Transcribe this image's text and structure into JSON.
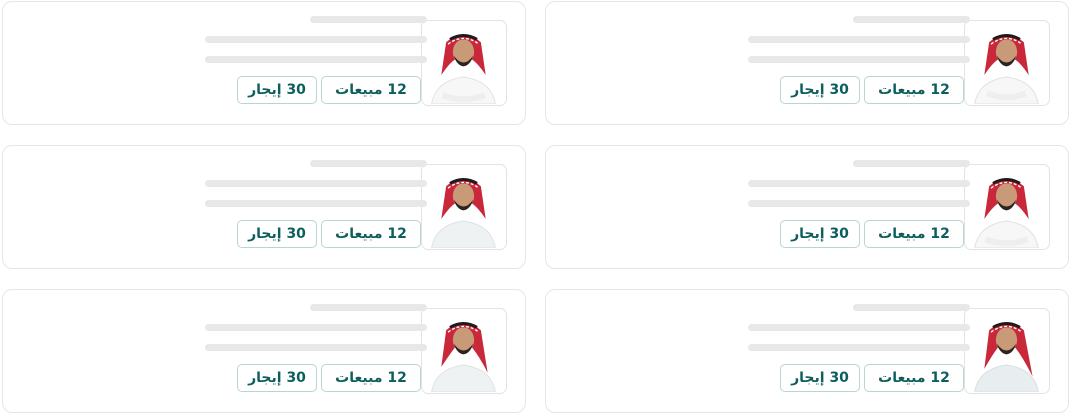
{
  "cards": [
    {
      "sales_label": "12 مبيعات",
      "rent_label": "30 إيجار"
    },
    {
      "sales_label": "12 مبيعات",
      "rent_label": "30 إيجار"
    },
    {
      "sales_label": "12 مبيعات",
      "rent_label": "30 إيجار"
    },
    {
      "sales_label": "12 مبيعات",
      "rent_label": "30 إيجار"
    },
    {
      "sales_label": "12 مبيعات",
      "rent_label": "30 إيجار"
    },
    {
      "sales_label": "12 مبيعات",
      "rent_label": "30 إيجار"
    }
  ],
  "colors": {
    "tag_text": "#0d5f5c",
    "tag_border": "#b5d6d3",
    "skeleton": "#e8e8e8",
    "card_border": "#e6e6e6",
    "shemagh_red": "#c8283a"
  }
}
